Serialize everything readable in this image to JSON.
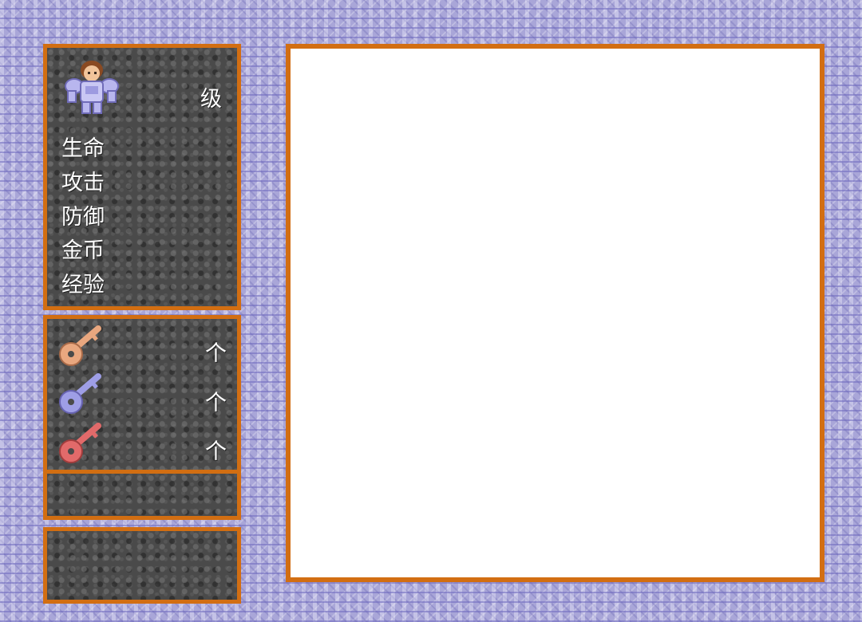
{
  "status": {
    "level_unit": "级",
    "stats": [
      {
        "label": "生命"
      },
      {
        "label": "攻击"
      },
      {
        "label": "防御"
      },
      {
        "label": "金币"
      },
      {
        "label": "经验"
      }
    ]
  },
  "keys": [
    {
      "icon": "yellow-key-icon",
      "unit": "个",
      "color": "#e9a77f"
    },
    {
      "icon": "blue-key-icon",
      "unit": "个",
      "color": "#9e9ee6"
    },
    {
      "icon": "red-key-icon",
      "unit": "个",
      "color": "#e26a6a"
    }
  ],
  "colors": {
    "frame": "#d26e12",
    "panel": "#4a4a4a",
    "main_bg": "#ffffff"
  }
}
